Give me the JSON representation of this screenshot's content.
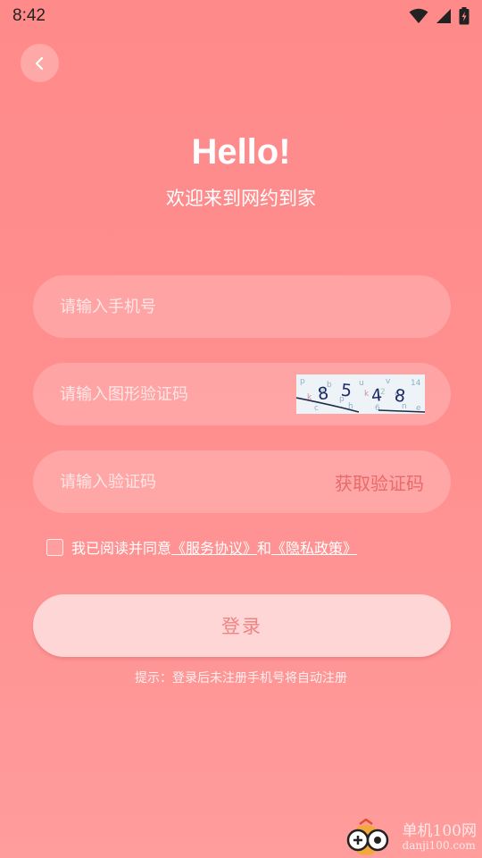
{
  "status_bar": {
    "time": "8:42"
  },
  "header": {
    "title": "Hello!",
    "subtitle": "欢迎来到网约到家"
  },
  "form": {
    "phone_placeholder": "请输入手机号",
    "captcha_placeholder": "请输入图形验证码",
    "captcha_digits": [
      "8",
      "5",
      "4",
      "8"
    ],
    "code_placeholder": "请输入验证码",
    "get_code_label": "获取验证码"
  },
  "agreement": {
    "prefix": "我已阅读并同意",
    "service_link": "《服务协议》",
    "and": "和",
    "privacy_link": "《隐私政策》"
  },
  "login": {
    "label": "登录"
  },
  "hint": "提示：登录后未注册手机号将自动注册",
  "watermark": {
    "title": "单机100网",
    "url": "danji100.com"
  },
  "colors": {
    "accent": "#e86a6a",
    "background": "#ff8a8a",
    "login_button": "#ffd6d6"
  }
}
